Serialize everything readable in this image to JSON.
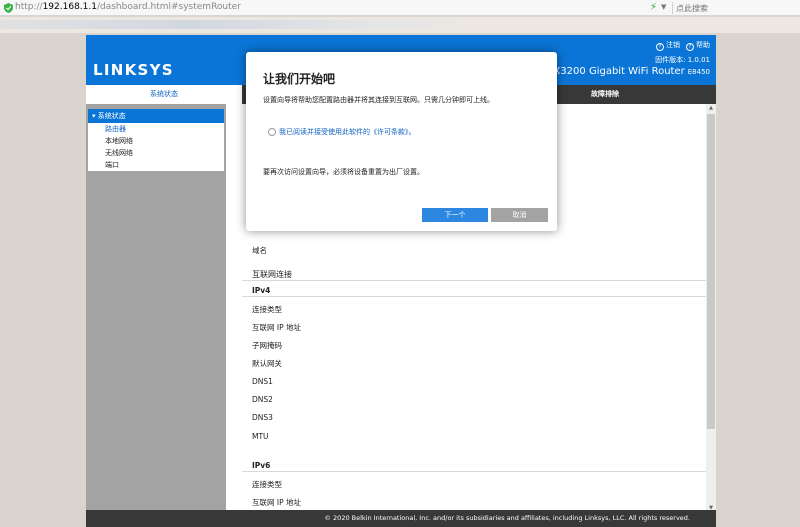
{
  "browser": {
    "url_scheme": "http://",
    "url_host": "192.168.1.1",
    "url_path": "/dashboard.html#systemRouter",
    "search_placeholder": "点此搜索"
  },
  "header": {
    "logo": "LINKSYS",
    "help_icon_glyph": "?",
    "logout": "注销",
    "help": "帮助",
    "firmware": "固件版本: 1.0.01",
    "model_name": "AX3200 Gigabit WiFi Router",
    "model_code": "E8450"
  },
  "nav": {
    "active_tab": "系统状态",
    "troubleshoot_tab": "故障排除"
  },
  "sidebar": {
    "section": "系统状态",
    "items": [
      {
        "label": "路由器"
      },
      {
        "label": "本地网络"
      },
      {
        "label": "无线网络"
      },
      {
        "label": "端口"
      }
    ]
  },
  "content": {
    "hostname_label": "域名",
    "internet_section": "互联网连接",
    "ipv4": {
      "title": "IPv4",
      "rows": [
        "连接类型",
        "互联网 IP 地址",
        "子网掩码",
        "默认网关",
        "DNS1",
        "DNS2",
        "DNS3",
        "MTU"
      ]
    },
    "ipv6": {
      "title": "IPv6",
      "rows": [
        "连接类型",
        "互联网 IP 地址"
      ]
    }
  },
  "footer": {
    "copyright": "© 2020 Belkin International, Inc. and/or its subsidiaries and affiliates, including Linksys, LLC. All rights reserved."
  },
  "modal": {
    "title": "让我们开始吧",
    "description": "设置向导将帮助您配置路由器并将其连接到互联网。只需几分钟即可上线。",
    "license_label": "我已阅读并接受使用此软件的《许可条款》。",
    "note": "要再次访问设置向导，必须将设备重置为出厂设置。",
    "next_label": "下一个",
    "cancel_label": "取消"
  },
  "colors": {
    "brand_blue": "#0a75d6",
    "nav_dark": "#383838",
    "sidebar_gray": "#a3a3a3",
    "link_blue": "#1261c4"
  }
}
